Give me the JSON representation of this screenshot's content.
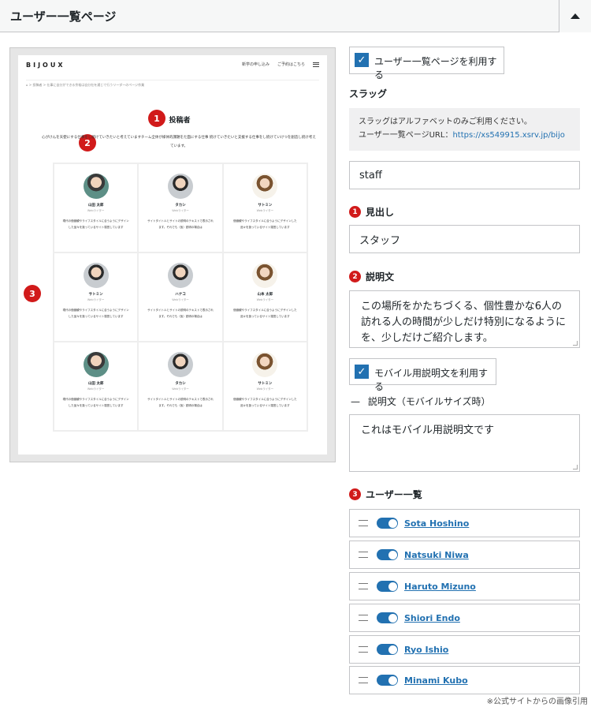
{
  "header": {
    "title": "ユーザー一覧ページ"
  },
  "preview": {
    "logo": "BIJOUX",
    "nav": [
      "新学の申し込み",
      "ご予約はこちら"
    ],
    "breadcrumb": "⌂  >  投稿者  >  仕事に自分ができる余裕は自分社を通じて行うリーダーのページ作業",
    "title": "投稿者",
    "description": "心がけんを天使にする仕事をし続けていきたいと考えていますチーム全体が様体的課題をた面にする仕事 続けていきたいと支援する仕事をし続けていけつを創造し続け考えています。",
    "cells": [
      {
        "name": "山田 太郎",
        "role": "Webライター",
        "text": "現代の価値観やライフスタイルに合うようにデザインした品々を扱っているサイト運営しています"
      },
      {
        "name": "タカシ",
        "role": "Webライター",
        "text": "サイトタイトルとサイトの説明のテキストで表示されます。それでも（仮）説明の場合は"
      },
      {
        "name": "サトミン",
        "role": "Webライター",
        "text": "価値観やライフスタイルに合うようにデザインした品々を扱っているサイト運営しています"
      },
      {
        "name": "サトミン",
        "role": "Webライター",
        "text": "現代の価値観やライフスタイルに合うようにデザインした品々を扱っているサイト運営しています"
      },
      {
        "name": "ハナコ",
        "role": "Webライター",
        "text": "サイトタイトルとサイトの説明のテキストで表示されます。それでも（仮）説明の場合は"
      },
      {
        "name": "山本 太郎",
        "role": "Webライター",
        "text": "価値観やライフスタイルに合うようにデザインした品々を扱っているサイト運営しています"
      },
      {
        "name": "山田 太郎",
        "role": "Webライター",
        "text": "現代の価値観やライフスタイルに合うようにデザインした品々を扱っているサイト運営しています"
      },
      {
        "name": "タカシ",
        "role": "Webライター",
        "text": "サイトタイトルとサイトの説明のテキストで表示されます。それでも（仮）説明の場合は"
      },
      {
        "name": "サトミン",
        "role": "Webライター",
        "text": "価値観やライフスタイルに合うようにデザインした品々を扱っているサイト運営しています"
      }
    ],
    "badges": [
      "1",
      "2",
      "3"
    ]
  },
  "settings": {
    "enable_page": {
      "label": "ユーザー一覧ページを利用する",
      "checked": true
    },
    "slug": {
      "label": "スラッグ",
      "help_line1": "スラッグはアルファベットのみご利用ください。",
      "help_line2_prefix": "ユーザー一覧ページURL：",
      "help_url": "https://xs549915.xsrv.jp/bijo",
      "value": "staff"
    },
    "heading": {
      "badge": "1",
      "label": "見出し",
      "value": "スタッフ"
    },
    "description": {
      "badge": "2",
      "label": "説明文",
      "line1": "この場所をかたちづくる、個性豊かな6人の",
      "line2": "訪れる人の時間が少しだけ特別になるように",
      "line3": "を、少しだけご紹介します。"
    },
    "mobile": {
      "checkbox_label": "モバイル用説明文を利用する",
      "checked": true,
      "dash": "—",
      "label": "説明文（モバイルサイズ時）",
      "value": "これはモバイル用説明文です"
    },
    "users": {
      "badge": "3",
      "label": "ユーザー一覧",
      "items": [
        "Sota Hoshino",
        "Natsuki Niwa",
        "Haruto Mizuno",
        "Shiori Endo",
        "Ryo Ishio",
        "Minami Kubo"
      ]
    }
  },
  "footnote": "※公式サイトからの画像引用",
  "colors": {
    "accent": "#2271b1",
    "badge": "#d11a1a"
  }
}
